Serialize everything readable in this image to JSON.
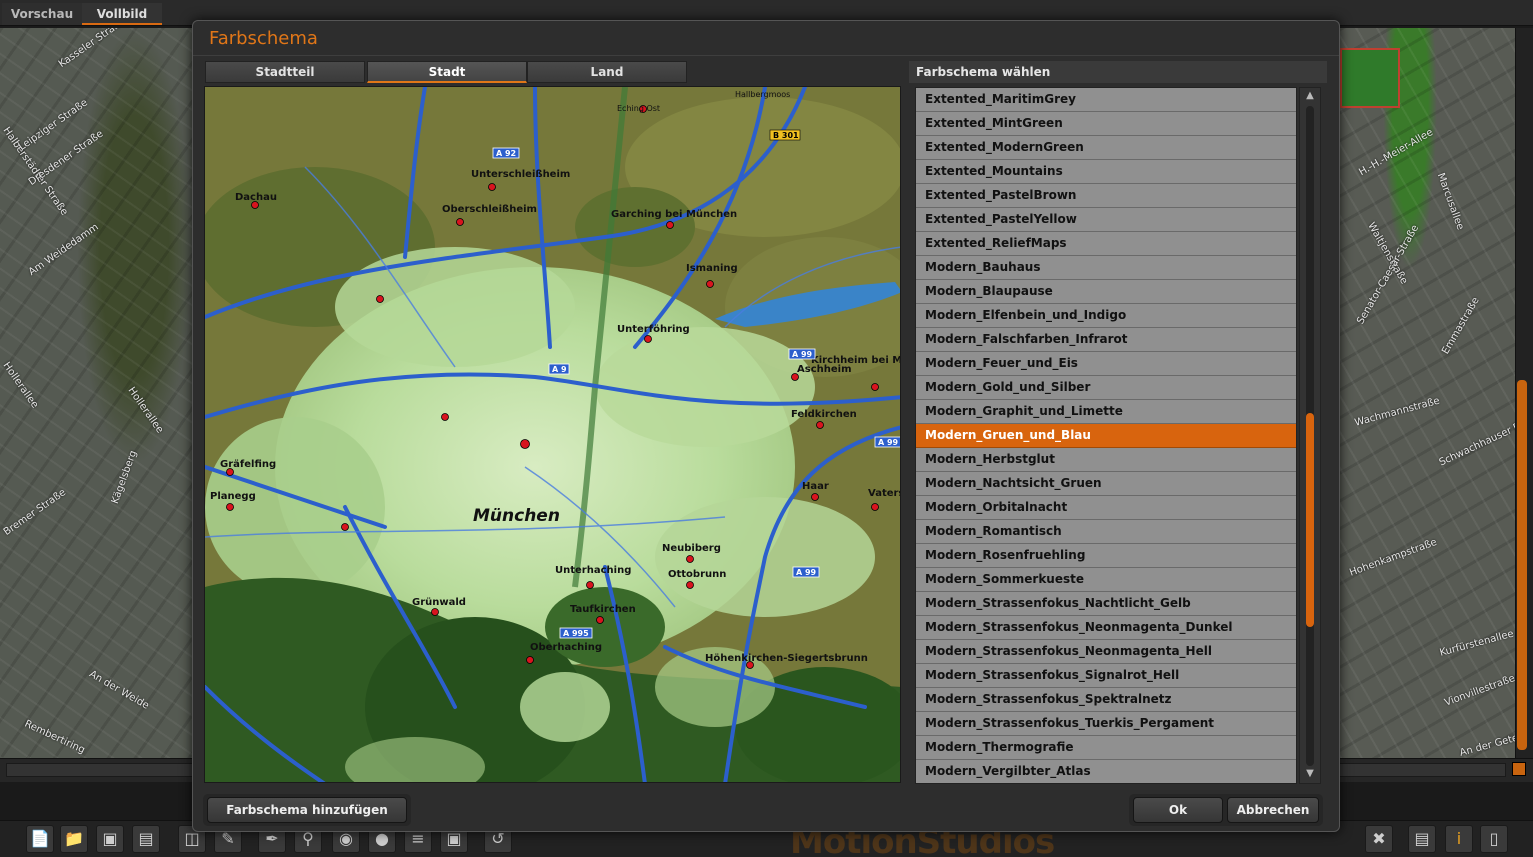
{
  "app": {
    "top_tabs": [
      {
        "label": "Vorschau",
        "active": false
      },
      {
        "label": "Vollbild",
        "active": true
      }
    ],
    "brand_text": "MotionStudios",
    "bg_streets_left": [
      "Kasseler Straße",
      "Halberstädter Straße",
      "Dresdener Straße",
      "Leipziger Straße",
      "Am Weidedamm",
      "Hollerallee",
      "Hollerallee",
      "Bremer Straße",
      "An der Weide",
      "Rembertiring",
      "Kägelsberg"
    ],
    "bg_streets_right": [
      "H.-H.-Meier-Allee",
      "Marcusallee",
      "Waltjenstraße",
      "Senator-Caesar-Straße",
      "Emmastraße",
      "Schwachhauser Ring",
      "Wachmannstraße",
      "Kurfürstenallee",
      "Vionvillestraße",
      "An der Gete",
      "Hohenkampstraße"
    ],
    "accent_color": "#d8640e"
  },
  "dialog": {
    "title": "Farbschema",
    "tabs": [
      {
        "label": "Stadtteil",
        "active": false
      },
      {
        "label": "Stadt",
        "active": true
      },
      {
        "label": "Land",
        "active": false
      }
    ],
    "preview": {
      "city_label": "München",
      "place_labels": [
        "Unterschleißheim",
        "Oberschleißheim",
        "Garching bei München",
        "Ismaning",
        "Dachau",
        "Unterföhring",
        "Kirchheim bei München",
        "Aschheim",
        "Feldkirchen",
        "Haar",
        "Gräfelfing",
        "Planegg",
        "Neubiberg",
        "Ottobrunn",
        "Unterhaching",
        "Taufkirchen",
        "Oberhaching",
        "Grünwald",
        "Höhenkirchen-Siegertsbrunn",
        "Vaterstetten",
        "Eching Ost",
        "Hallbergmoos"
      ],
      "road_shields": [
        "A 92",
        "B 301",
        "A 9",
        "A 99",
        "A 99",
        "A 995",
        "A 99"
      ]
    },
    "list_header": "Farbschema wählen",
    "schemes": [
      "Extented_MaritimGrey",
      "Extented_MintGreen",
      "Extented_ModernGreen",
      "Extented_Mountains",
      "Extented_PastelBrown",
      "Extented_PastelYellow",
      "Extented_ReliefMaps",
      "Modern_Bauhaus",
      "Modern_Blaupause",
      "Modern_Elfenbein_und_Indigo",
      "Modern_Falschfarben_Infrarot",
      "Modern_Feuer_und_Eis",
      "Modern_Gold_und_Silber",
      "Modern_Graphit_und_Limette",
      "Modern_Gruen_und_Blau",
      "Modern_Herbstglut",
      "Modern_Nachtsicht_Gruen",
      "Modern_Orbitalnacht",
      "Modern_Romantisch",
      "Modern_Rosenfruehling",
      "Modern_Sommerkueste",
      "Modern_Strassenfokus_Nachtlicht_Gelb",
      "Modern_Strassenfokus_Neonmagenta_Dunkel",
      "Modern_Strassenfokus_Neonmagenta_Hell",
      "Modern_Strassenfokus_Signalrot_Hell",
      "Modern_Strassenfokus_Spektralnetz",
      "Modern_Strassenfokus_Tuerkis_Pergament",
      "Modern_Thermografie",
      "Modern_Vergilbter_Atlas"
    ],
    "selected_scheme": "Modern_Gruen_und_Blau",
    "buttons": {
      "add": "Farbschema hinzufügen",
      "ok": "Ok",
      "cancel": "Abbrechen"
    }
  },
  "toolbar_icons": [
    "new-file-icon",
    "open-folder-icon",
    "save-icon",
    "save-as-icon",
    "screen-icon",
    "brush-icon",
    "pen-icon",
    "search-icon",
    "camera-icon",
    "marker-icon",
    "layers-icon",
    "lock-icon",
    "undo-icon",
    "tools-icon",
    "book-icon",
    "info-icon",
    "trash-icon"
  ]
}
